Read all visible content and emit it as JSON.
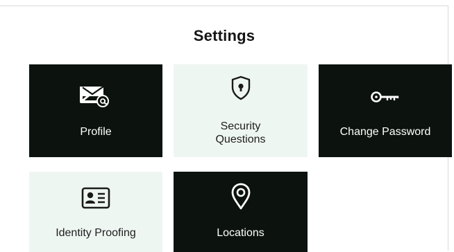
{
  "page": {
    "title": "Settings"
  },
  "tiles": [
    {
      "label": "Profile",
      "icon": "envelope-at-icon",
      "style": "dark"
    },
    {
      "label_lines": [
        "Security",
        "Questions"
      ],
      "icon": "shield-lock-icon",
      "style": "light"
    },
    {
      "label": "Change Password",
      "icon": "key-icon",
      "style": "dark"
    },
    {
      "label": "Identity Proofing",
      "icon": "id-card-icon",
      "style": "light"
    },
    {
      "label": "Locations",
      "icon": "map-pin-icon",
      "style": "dark"
    }
  ],
  "colors": {
    "tile_dark": "#0c130f",
    "tile_light": "#eef6f2",
    "text_dark": "#141414",
    "text_light": "#ffffff"
  }
}
